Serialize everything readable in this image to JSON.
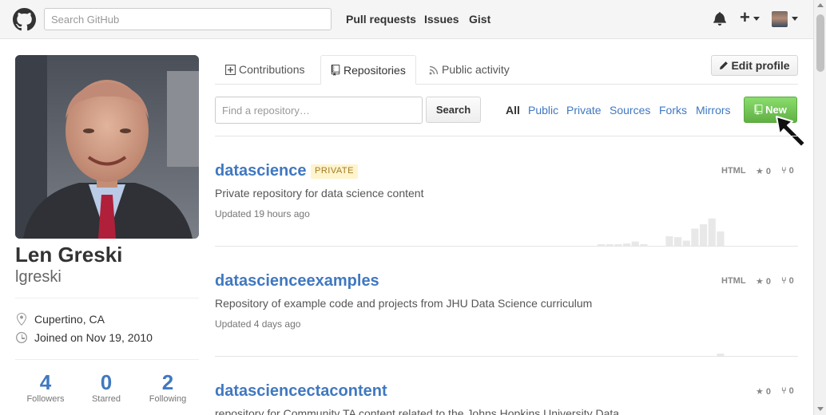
{
  "header": {
    "search_placeholder": "Search GitHub",
    "nav": [
      "Pull requests",
      "Issues",
      "Gist"
    ]
  },
  "profile": {
    "fullname": "Len Greski",
    "username": "lgreski",
    "location": "Cupertino, CA",
    "joined": "Joined on Nov 19, 2010",
    "stats": [
      {
        "num": "4",
        "label": "Followers"
      },
      {
        "num": "0",
        "label": "Starred"
      },
      {
        "num": "2",
        "label": "Following"
      }
    ]
  },
  "tabs": [
    "Contributions",
    "Repositories",
    "Public activity"
  ],
  "active_tab": "Repositories",
  "edit_profile": "Edit profile",
  "repo_search": {
    "placeholder": "Find a repository…",
    "button": "Search"
  },
  "filters": [
    "All",
    "Public",
    "Private",
    "Sources",
    "Forks",
    "Mirrors"
  ],
  "new_button": "New",
  "repos": [
    {
      "name": "datascience",
      "badge": "PRIVATE",
      "description": "Private repository for data science content",
      "updated": "Updated 19 hours ago",
      "language": "HTML",
      "stars": "0",
      "forks": "0",
      "activity": [
        0.05,
        0.02,
        0.02,
        0.08,
        0.15,
        0.06,
        0,
        0,
        0.33,
        0.3,
        0.18,
        0.6,
        0.75,
        0.95,
        0.5
      ]
    },
    {
      "name": "datascienceexamples",
      "description": "Repository of example code and projects from JHU Data Science curriculum",
      "updated": "Updated 4 days ago",
      "language": "HTML",
      "stars": "0",
      "forks": "0",
      "activity": [
        0,
        0,
        0,
        0,
        0,
        0,
        0,
        0,
        0,
        0,
        0,
        0,
        0,
        0,
        0.08
      ]
    },
    {
      "name": "datasciencectacontent",
      "description": "repository for Community TA content related to the Johns Hopkins University Data",
      "stars": "0",
      "forks": "0"
    }
  ],
  "colors": {
    "link": "#4078c0",
    "new_button": "#60b044",
    "private_badge_bg": "#fff4cc"
  }
}
